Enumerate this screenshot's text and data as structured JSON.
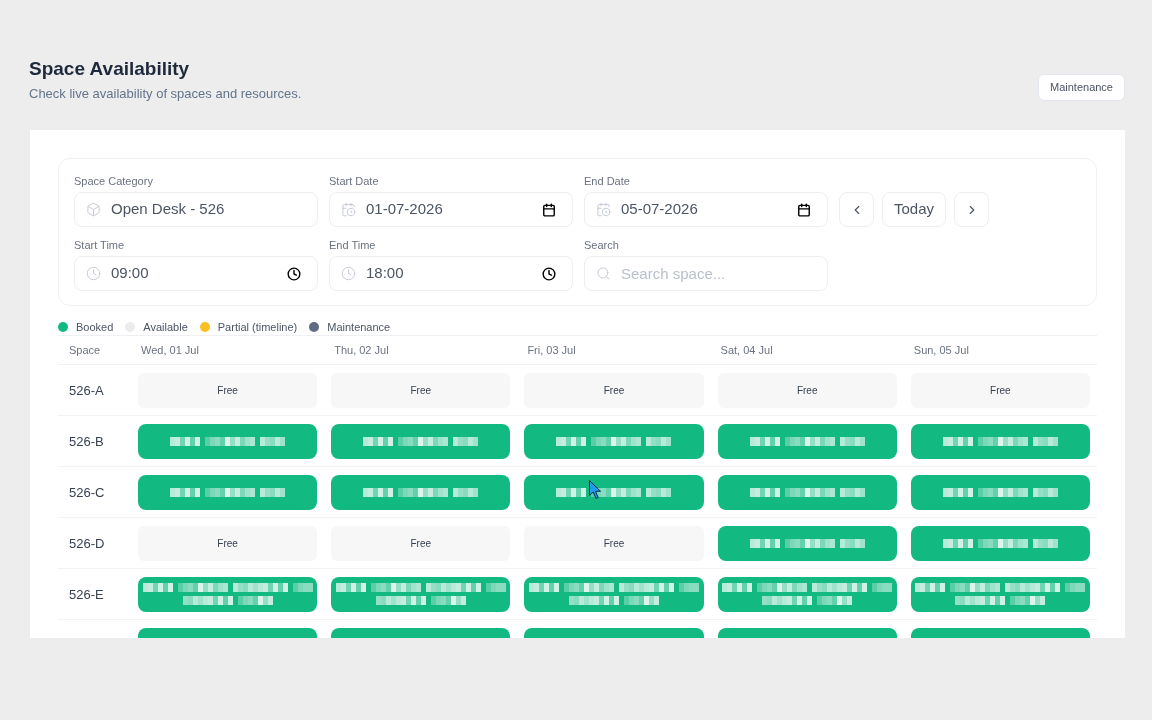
{
  "page": {
    "title": "Space Availability",
    "subtitle": "Check live availability of spaces and resources."
  },
  "header_actions": [
    {
      "label": "Maintenance"
    }
  ],
  "filters": {
    "fields": [
      {
        "kind": "select",
        "label": "Space Category",
        "value": "Open Desk - 526"
      },
      {
        "kind": "date",
        "label": "Start Date",
        "value": "01-07-2026"
      },
      {
        "kind": "date",
        "label": "End Date",
        "value": "05-07-2026"
      },
      {
        "kind": "time",
        "label": "Start Time",
        "value": "09:00"
      },
      {
        "kind": "time",
        "label": "End Time",
        "value": "18:00"
      },
      {
        "kind": "search",
        "label": "Search",
        "placeholder": "Search space..."
      }
    ],
    "nav_buttons": [
      {
        "kind": "prev"
      },
      {
        "kind": "today",
        "label": "Today"
      },
      {
        "kind": "next"
      }
    ]
  },
  "legend": [
    {
      "label": "Booked",
      "color": "#10b981"
    },
    {
      "label": "Available",
      "color": "#ececee"
    },
    {
      "label": "Partial (timeline)",
      "color": "#fbbf24"
    },
    {
      "label": "Maintenance",
      "color": "#5f6b80"
    }
  ],
  "table": {
    "columns": [
      "Space",
      "Wed, 01 Jul",
      "Thu, 02 Jul",
      "Fri, 03 Jul",
      "Sat, 04 Jul",
      "Sun, 05 Jul"
    ],
    "rows": [
      {
        "space": "526-A",
        "cells": [
          {
            "kind": "free",
            "label": "Free"
          },
          {
            "kind": "free",
            "label": "Free"
          },
          {
            "kind": "free",
            "label": "Free"
          },
          {
            "kind": "free",
            "label": "Free"
          },
          {
            "kind": "free",
            "label": "Free"
          }
        ]
      },
      {
        "space": "526-B",
        "cells": [
          {
            "kind": "booked",
            "wrapped": false
          },
          {
            "kind": "booked",
            "wrapped": false
          },
          {
            "kind": "booked",
            "wrapped": false
          },
          {
            "kind": "booked",
            "wrapped": false
          },
          {
            "kind": "booked",
            "wrapped": false
          }
        ]
      },
      {
        "space": "526-C",
        "cells": [
          {
            "kind": "booked",
            "wrapped": false
          },
          {
            "kind": "booked",
            "wrapped": false
          },
          {
            "kind": "booked",
            "wrapped": false
          },
          {
            "kind": "booked",
            "wrapped": false
          },
          {
            "kind": "booked",
            "wrapped": false
          }
        ]
      },
      {
        "space": "526-D",
        "cells": [
          {
            "kind": "free",
            "label": "Free"
          },
          {
            "kind": "free",
            "label": "Free"
          },
          {
            "kind": "free",
            "label": "Free"
          },
          {
            "kind": "booked",
            "wrapped": false
          },
          {
            "kind": "booked",
            "wrapped": false
          }
        ]
      },
      {
        "space": "526-E",
        "cells": [
          {
            "kind": "booked",
            "wrapped": true
          },
          {
            "kind": "booked",
            "wrapped": true
          },
          {
            "kind": "booked",
            "wrapped": true
          },
          {
            "kind": "booked",
            "wrapped": true
          },
          {
            "kind": "booked",
            "wrapped": true
          }
        ]
      },
      {
        "cells": [
          {
            "kind": "booked"
          },
          {
            "kind": "booked"
          },
          {
            "kind": "booked"
          },
          {
            "kind": "booked"
          },
          {
            "kind": "booked"
          }
        ]
      }
    ]
  }
}
